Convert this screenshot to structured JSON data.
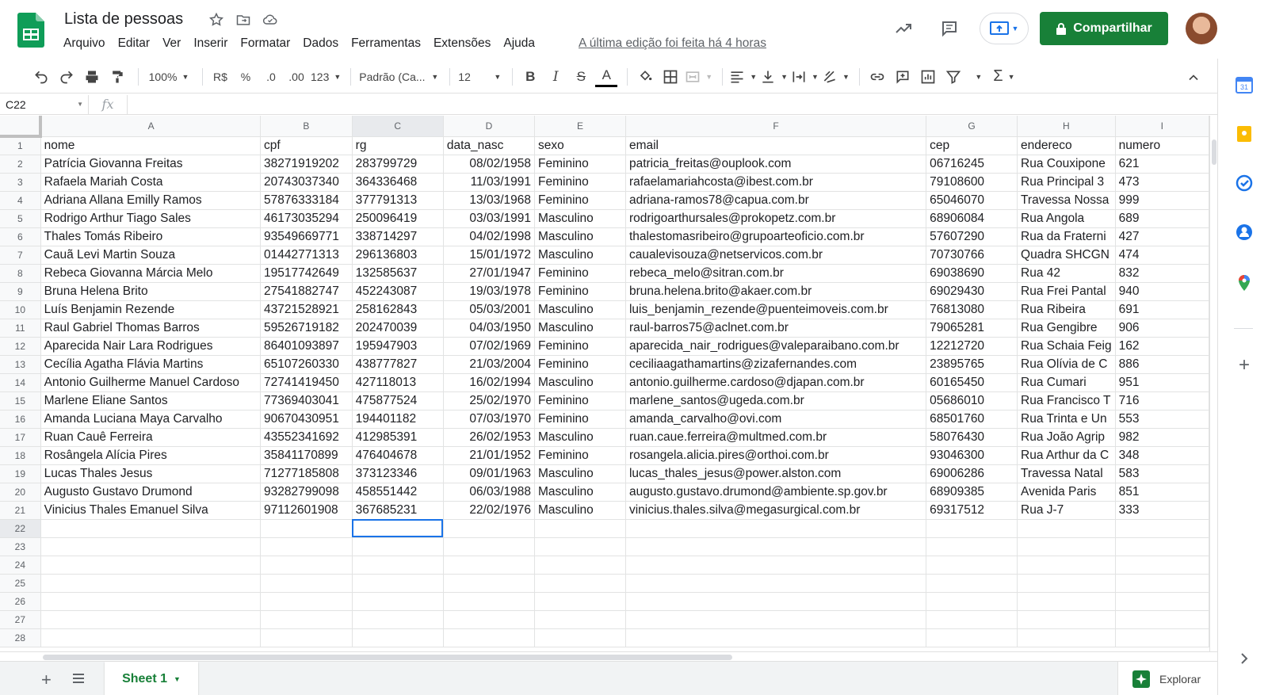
{
  "doc": {
    "title": "Lista de pessoas",
    "last_edit": "A última edição foi feita há 4 horas",
    "share_label": "Compartilhar"
  },
  "menu": [
    "Arquivo",
    "Editar",
    "Ver",
    "Inserir",
    "Formatar",
    "Dados",
    "Ferramentas",
    "Extensões",
    "Ajuda"
  ],
  "toolbar": {
    "zoom": "100%",
    "currency": "R$",
    "percent": "%",
    "dec_less": ".0",
    "dec_more": ".00",
    "more_formats": "123",
    "font": "Padrão (Ca...",
    "font_size": "12"
  },
  "formula_bar": {
    "cell_ref": "C22",
    "fx": "fx",
    "value": ""
  },
  "grid": {
    "columns": [
      "A",
      "B",
      "C",
      "D",
      "E",
      "F",
      "G",
      "H",
      "I"
    ],
    "selected_col": "C",
    "selected_row": "22",
    "row_numbers": [
      "1",
      "2",
      "3",
      "4",
      "5",
      "6",
      "7",
      "8",
      "9",
      "10",
      "11",
      "12",
      "13",
      "14",
      "15",
      "16",
      "17",
      "18",
      "19",
      "20",
      "21",
      "22",
      "23",
      "24",
      "25",
      "26",
      "27",
      "28"
    ],
    "headers": [
      "nome",
      "cpf",
      "rg",
      "data_nasc",
      "sexo",
      "email",
      "cep",
      "endereco",
      "numero"
    ],
    "rows": [
      [
        "Patrícia Giovanna Freitas",
        "38271919202",
        "283799729",
        "08/02/1958",
        "Feminino",
        "patricia_freitas@ouplook.com",
        "06716245",
        "Rua Couxipone",
        "621"
      ],
      [
        "Rafaela Mariah Costa",
        "20743037340",
        "364336468",
        "11/03/1991",
        "Feminino",
        "rafaelamariahcosta@ibest.com.br",
        "79108600",
        "Rua Principal 3",
        "473"
      ],
      [
        "Adriana Allana Emilly Ramos",
        "57876333184",
        "377791313",
        "13/03/1968",
        "Feminino",
        "adriana-ramos78@capua.com.br",
        "65046070",
        "Travessa Nossa",
        "999"
      ],
      [
        "Rodrigo Arthur Tiago Sales",
        "46173035294",
        "250096419",
        "03/03/1991",
        "Masculino",
        "rodrigoarthursales@prokopetz.com.br",
        "68906084",
        "Rua Angola",
        "689"
      ],
      [
        "Thales Tomás Ribeiro",
        "93549669771",
        "338714297",
        "04/02/1998",
        "Masculino",
        "thalestomasribeiro@grupoarteoficio.com.br",
        "57607290",
        "Rua da Fraterni",
        "427"
      ],
      [
        "Cauã Levi Martin Souza",
        "01442771313",
        "296136803",
        "15/01/1972",
        "Masculino",
        "caualevisouza@netservicos.com.br",
        "70730766",
        "Quadra SHCGN",
        "474"
      ],
      [
        "Rebeca Giovanna Márcia Melo",
        "19517742649",
        "132585637",
        "27/01/1947",
        "Feminino",
        "rebeca_melo@sitran.com.br",
        "69038690",
        "Rua 42",
        "832"
      ],
      [
        "Bruna Helena Brito",
        "27541882747",
        "452243087",
        "19/03/1978",
        "Feminino",
        "bruna.helena.brito@akaer.com.br",
        "69029430",
        "Rua Frei Pantal",
        "940"
      ],
      [
        "Luís Benjamin Rezende",
        "43721528921",
        "258162843",
        "05/03/2001",
        "Masculino",
        "luis_benjamin_rezende@puenteimoveis.com.br",
        "76813080",
        "Rua Ribeira",
        "691"
      ],
      [
        "Raul Gabriel Thomas Barros",
        "59526719182",
        "202470039",
        "04/03/1950",
        "Masculino",
        "raul-barros75@aclnet.com.br",
        "79065281",
        "Rua Gengibre",
        "906"
      ],
      [
        "Aparecida Nair Lara Rodrigues",
        "86401093897",
        "195947903",
        "07/02/1969",
        "Feminino",
        "aparecida_nair_rodrigues@valeparaibano.com.br",
        "12212720",
        "Rua Schaia Feig",
        "162"
      ],
      [
        "Cecília Agatha Flávia Martins",
        "65107260330",
        "438777827",
        "21/03/2004",
        "Feminino",
        "ceciliaagathamartins@zizafernandes.com",
        "23895765",
        "Rua Olívia de C",
        "886"
      ],
      [
        "Antonio Guilherme Manuel Cardoso",
        "72741419450",
        "427118013",
        "16/02/1994",
        "Masculino",
        "antonio.guilherme.cardoso@djapan.com.br",
        "60165450",
        "Rua Cumari",
        "951"
      ],
      [
        "Marlene Eliane Santos",
        "77369403041",
        "475877524",
        "25/02/1970",
        "Feminino",
        "marlene_santos@ugeda.com.br",
        "05686010",
        "Rua Francisco T",
        "716"
      ],
      [
        "Amanda Luciana Maya Carvalho",
        "90670430951",
        "194401182",
        "07/03/1970",
        "Feminino",
        "amanda_carvalho@ovi.com",
        "68501760",
        "Rua Trinta e Un",
        "553"
      ],
      [
        "Ruan Cauê Ferreira",
        "43552341692",
        "412985391",
        "26/02/1953",
        "Masculino",
        "ruan.caue.ferreira@multmed.com.br",
        "58076430",
        "Rua João Agrip",
        "982"
      ],
      [
        "Rosângela Alícia Pires",
        "35841170899",
        "476404678",
        "21/01/1952",
        "Feminino",
        "rosangela.alicia.pires@orthoi.com.br",
        "93046300",
        "Rua Arthur da C",
        "348"
      ],
      [
        "Lucas Thales Jesus",
        "71277185808",
        "373123346",
        "09/01/1963",
        "Masculino",
        "lucas_thales_jesus@power.alston.com",
        "69006286",
        "Travessa Natal",
        "583"
      ],
      [
        "Augusto Gustavo Drumond",
        "93282799098",
        "458551442",
        "06/03/1988",
        "Masculino",
        "augusto.gustavo.drumond@ambiente.sp.gov.br",
        "68909385",
        "Avenida Paris",
        "851"
      ],
      [
        "Vinicius Thales Emanuel Silva",
        "97112601908",
        "367685231",
        "22/02/1976",
        "Masculino",
        "vinicius.thales.silva@megasurgical.com.br",
        "69317512",
        "Rua J-7",
        "333"
      ]
    ]
  },
  "sheets": {
    "active": "Sheet 1"
  },
  "explore_label": "Explorar",
  "colors": {
    "brand_green": "#188038",
    "selection_blue": "#1a73e8"
  }
}
